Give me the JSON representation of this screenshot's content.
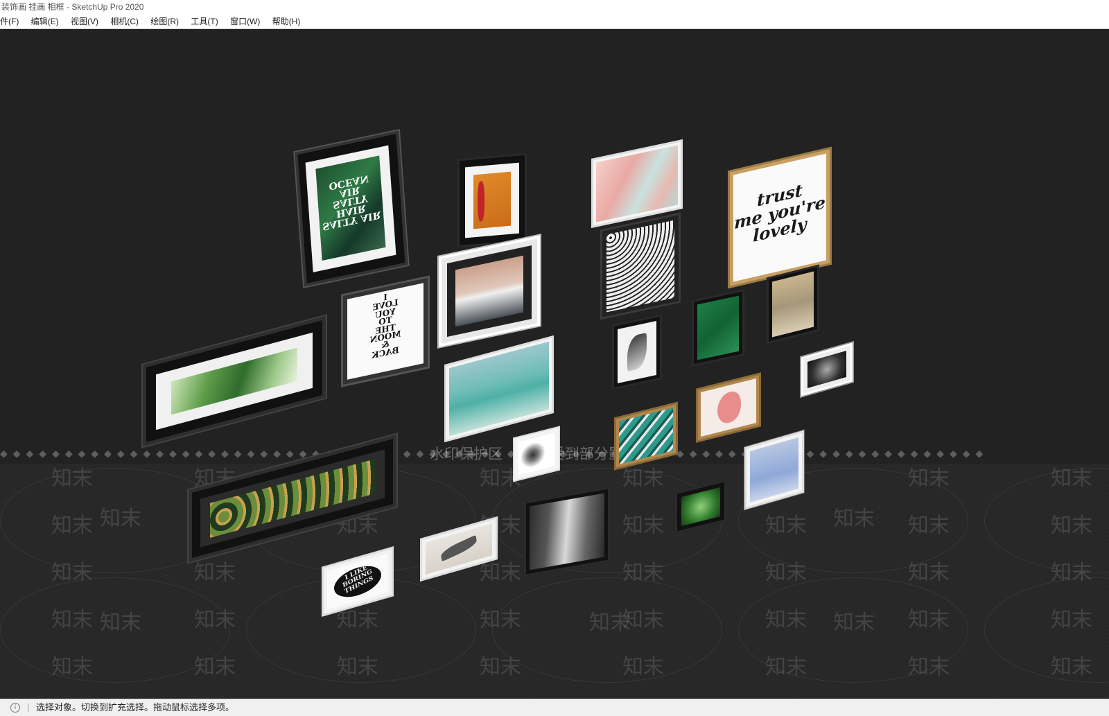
{
  "window": {
    "title": "装饰画 挂画 相框 - SketchUp Pro 2020"
  },
  "menu": [
    "件(F)",
    "编辑(E)",
    "视图(V)",
    "相机(C)",
    "绘图(R)",
    "工具(T)",
    "窗口(W)",
    "帮助(H)"
  ],
  "viewport": {
    "watermark_text": "知末",
    "watermark_banner": "水印保护区 　　　受到部分影响",
    "artworks": {
      "salty_air": "SALTY AIR\nHAIR\nSALTY\nAIR\nOCEAN",
      "love_moon": "I\nLOVE\nYOU\nTO\nTHE\nMOON\n&\nBACK",
      "trust_lovely": "trust\nme you're\nlovely",
      "like_things": "I LIKE\nBORING\nTHINGS"
    }
  },
  "status": {
    "text": "选择对象。切换到扩充选择。拖动鼠标选择多项。",
    "icon": "info-icon"
  }
}
